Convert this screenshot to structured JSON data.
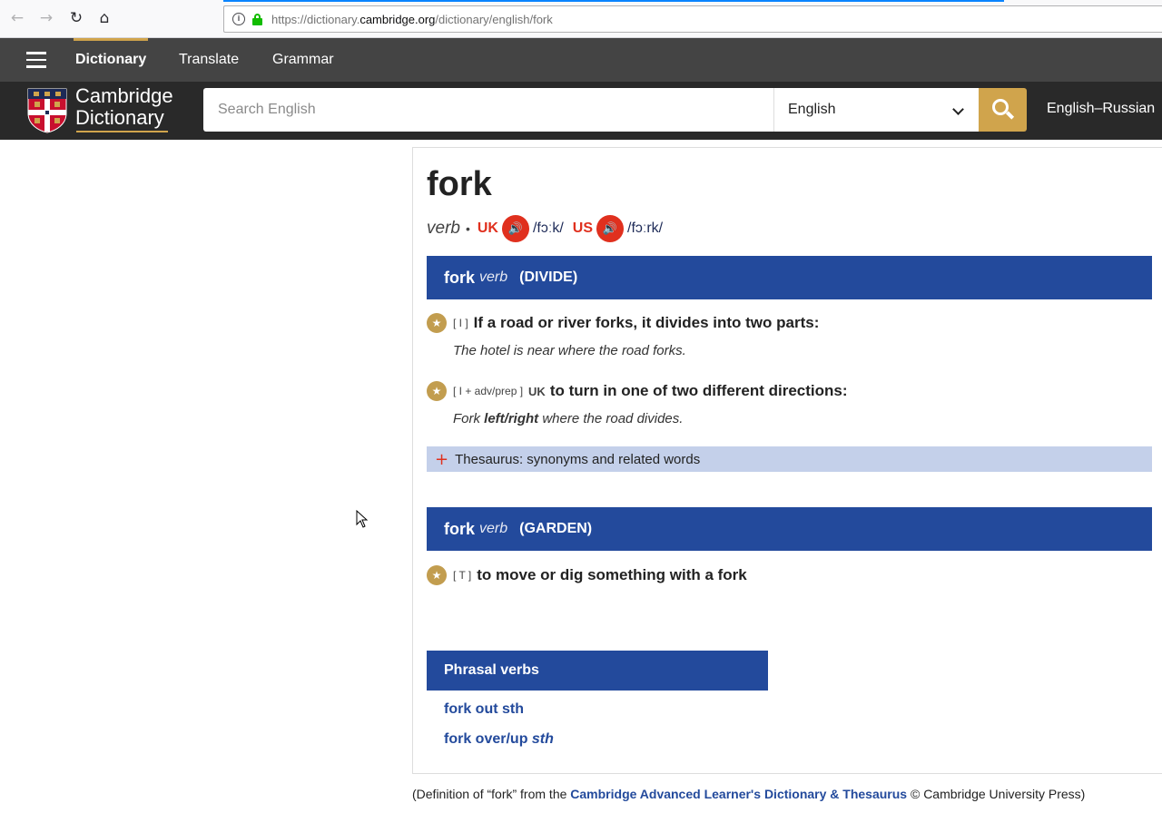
{
  "browser": {
    "url_prefix": "https://dictionary.",
    "url_domain": "cambridge.org",
    "url_path": "/dictionary/english/fork"
  },
  "topnav": {
    "tabs": [
      {
        "label": "Dictionary",
        "active": true
      },
      {
        "label": "Translate",
        "active": false
      },
      {
        "label": "Grammar",
        "active": false
      }
    ]
  },
  "header": {
    "logo_line1": "Cambridge",
    "logo_line2": "Dictionary",
    "search_placeholder": "Search English",
    "language": "English",
    "dictionary_link": "English–Russian"
  },
  "entry": {
    "headword": "fork",
    "pos": "verb",
    "uk_label": "UK",
    "uk_ipa": "/fɔːk/",
    "us_label": "US",
    "us_ipa": "/fɔːrk/",
    "senses": [
      {
        "headword": "fork",
        "pos": "verb",
        "guide": "(DIVIDE)",
        "definitions": [
          {
            "grammar": "[ I ]",
            "label": "",
            "text": "If a road or river forks, it divides into two parts:",
            "example": "The hotel is near where the road forks."
          },
          {
            "grammar": "[ I + adv/prep ]",
            "label": "UK",
            "text": "to turn in one of two different directions:",
            "example_pre": "Fork ",
            "example_bold": "left/right",
            "example_post": " where the road divides."
          }
        ],
        "thesaurus": "Thesaurus: synonyms and related words"
      },
      {
        "headword": "fork",
        "pos": "verb",
        "guide": "(GARDEN)",
        "definitions": [
          {
            "grammar": "[ T ]",
            "text": "to move or dig something with a fork"
          }
        ]
      }
    ],
    "phrasal_title": "Phrasal verbs",
    "phrasal_verbs": [
      {
        "main": "fork out sth",
        "italic": ""
      },
      {
        "main": "fork over/up ",
        "italic": "sth"
      }
    ]
  },
  "footer": {
    "pre": "(Definition of “fork” from the ",
    "source": "Cambridge Advanced Learner's Dictionary & Thesaurus",
    "post": " © Cambridge University Press)"
  },
  "colors": {
    "sense_bar": "#234a9c",
    "accent_gold": "#d0a44c",
    "audio_red": "#e0301e",
    "header_bg": "#292929",
    "nav_bg": "#444444",
    "thesaurus_bg": "#c4d0ea"
  }
}
